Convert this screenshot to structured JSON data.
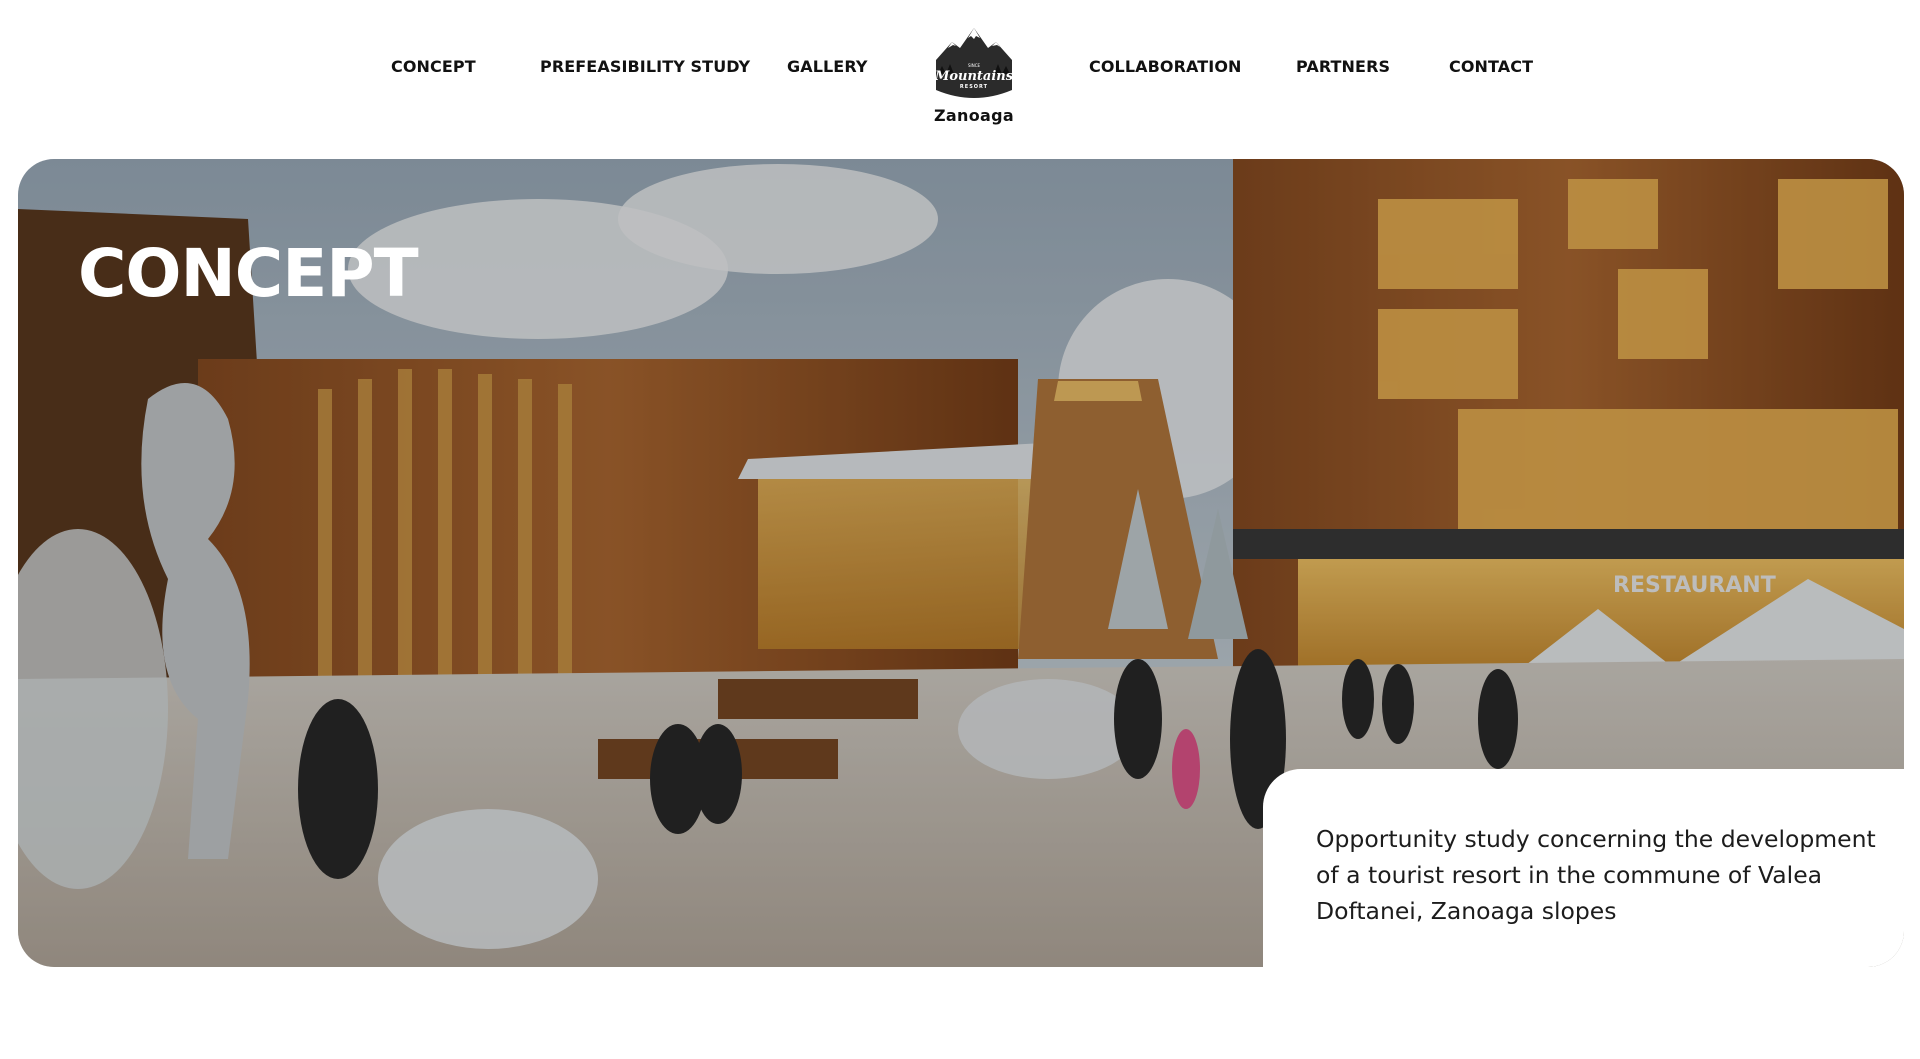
{
  "nav": {
    "left": [
      {
        "label": "CONCEPT"
      },
      {
        "label": "PREFEASIBILITY STUDY"
      },
      {
        "label": "GALLERY"
      }
    ],
    "right": [
      {
        "label": "COLLABORATION"
      },
      {
        "label": "PARTNERS"
      },
      {
        "label": "CONTACT"
      }
    ],
    "logo": {
      "brand": "Mountains",
      "resort": "RESORT",
      "since": "SINCE",
      "year": "1973",
      "subtitle": "Zanoaga",
      "icon": "mountain-logo-icon"
    }
  },
  "hero": {
    "title": "CONCEPT",
    "sign": "RESTAURANT",
    "description": "Opportunity study concerning the development of a tourist resort in the commune of Valea Doftanei, Zanoaga slopes"
  },
  "colors": {
    "text": "#111111",
    "card": "#ffffff",
    "overlay": "rgba(0,0,0,0.22)"
  }
}
